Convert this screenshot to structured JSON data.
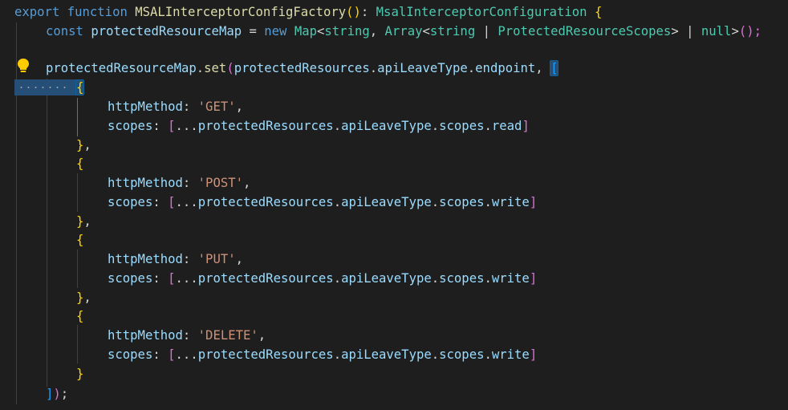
{
  "editor": {
    "line1": {
      "kw_export": "export",
      "kw_function": "function",
      "fn_name": "MSALInterceptorConfigFactory",
      "parens": "()",
      "colon": ": ",
      "return_type": "MsalInterceptorConfiguration",
      "brace_open": "{"
    },
    "line2": {
      "kw_const": "const",
      "var_name": "protectedResourceMap",
      "eq": " = ",
      "kw_new": "new",
      "type_map": "Map",
      "lt": "<",
      "t_string": "string",
      "comma": ", ",
      "type_array": "Array",
      "lt2": "<",
      "t_string2": "string",
      "pipe": " | ",
      "type_scopes": "ProtectedResourceScopes",
      "gt": ">",
      "pipe2": " | ",
      "kw_null": "null",
      "gt2": ">",
      "call": "();"
    },
    "line4": {
      "obj": "protectedResourceMap",
      "dot": ".",
      "method": "set",
      "paren_open": "(",
      "arg_obj": "protectedResources",
      "dot2": ".",
      "arg_prop": "apiLeaveType",
      "dot3": ".",
      "arg_field": "endpoint",
      "comma": ", ",
      "bracket_open": "["
    },
    "entries": [
      {
        "open": "{",
        "key1": "httpMethod",
        "colon1": ": ",
        "method": "'GET'",
        "comma1": ",",
        "key2": "scopes",
        "colon2": ": ",
        "arr_open": "[",
        "spread": "...",
        "obj": "protectedResources",
        "dot1": ".",
        "prop": "apiLeaveType",
        "dot2": ".",
        "scopes_word": "scopes",
        "dot3": ".",
        "access": "read",
        "arr_close": "]",
        "close": "}",
        "trail": ","
      },
      {
        "open": "{",
        "key1": "httpMethod",
        "colon1": ": ",
        "method": "'POST'",
        "comma1": ",",
        "key2": "scopes",
        "colon2": ": ",
        "arr_open": "[",
        "spread": "...",
        "obj": "protectedResources",
        "dot1": ".",
        "prop": "apiLeaveType",
        "dot2": ".",
        "scopes_word": "scopes",
        "dot3": ".",
        "access": "write",
        "arr_close": "]",
        "close": "}",
        "trail": ","
      },
      {
        "open": "{",
        "key1": "httpMethod",
        "colon1": ": ",
        "method": "'PUT'",
        "comma1": ",",
        "key2": "scopes",
        "colon2": ": ",
        "arr_open": "[",
        "spread": "...",
        "obj": "protectedResources",
        "dot1": ".",
        "prop": "apiLeaveType",
        "dot2": ".",
        "scopes_word": "scopes",
        "dot3": ".",
        "access": "write",
        "arr_close": "]",
        "close": "}",
        "trail": ","
      },
      {
        "open": "{",
        "key1": "httpMethod",
        "colon1": ": ",
        "method": "'DELETE'",
        "comma1": ",",
        "key2": "scopes",
        "colon2": ": ",
        "arr_open": "[",
        "spread": "...",
        "obj": "protectedResources",
        "dot1": ".",
        "prop": "apiLeaveType",
        "dot2": ".",
        "scopes_word": "scopes",
        "dot3": ".",
        "access": "write",
        "arr_close": "]",
        "close": "}",
        "trail": ""
      }
    ],
    "closing": {
      "bracket": "]",
      "paren": ")",
      "semi": ";"
    },
    "lightbulb_icon": "lightbulb-icon"
  },
  "colors": {
    "background": "#1e1e1e",
    "keyword": "#569cd6",
    "function": "#dcdcaa",
    "type": "#4ec9b0",
    "variable": "#9cdcfe",
    "string": "#ce9178",
    "bracket_level1": "#ffd700",
    "bracket_level2": "#da70d6",
    "bracket_level3": "#179fff",
    "selection": "#264f78"
  }
}
